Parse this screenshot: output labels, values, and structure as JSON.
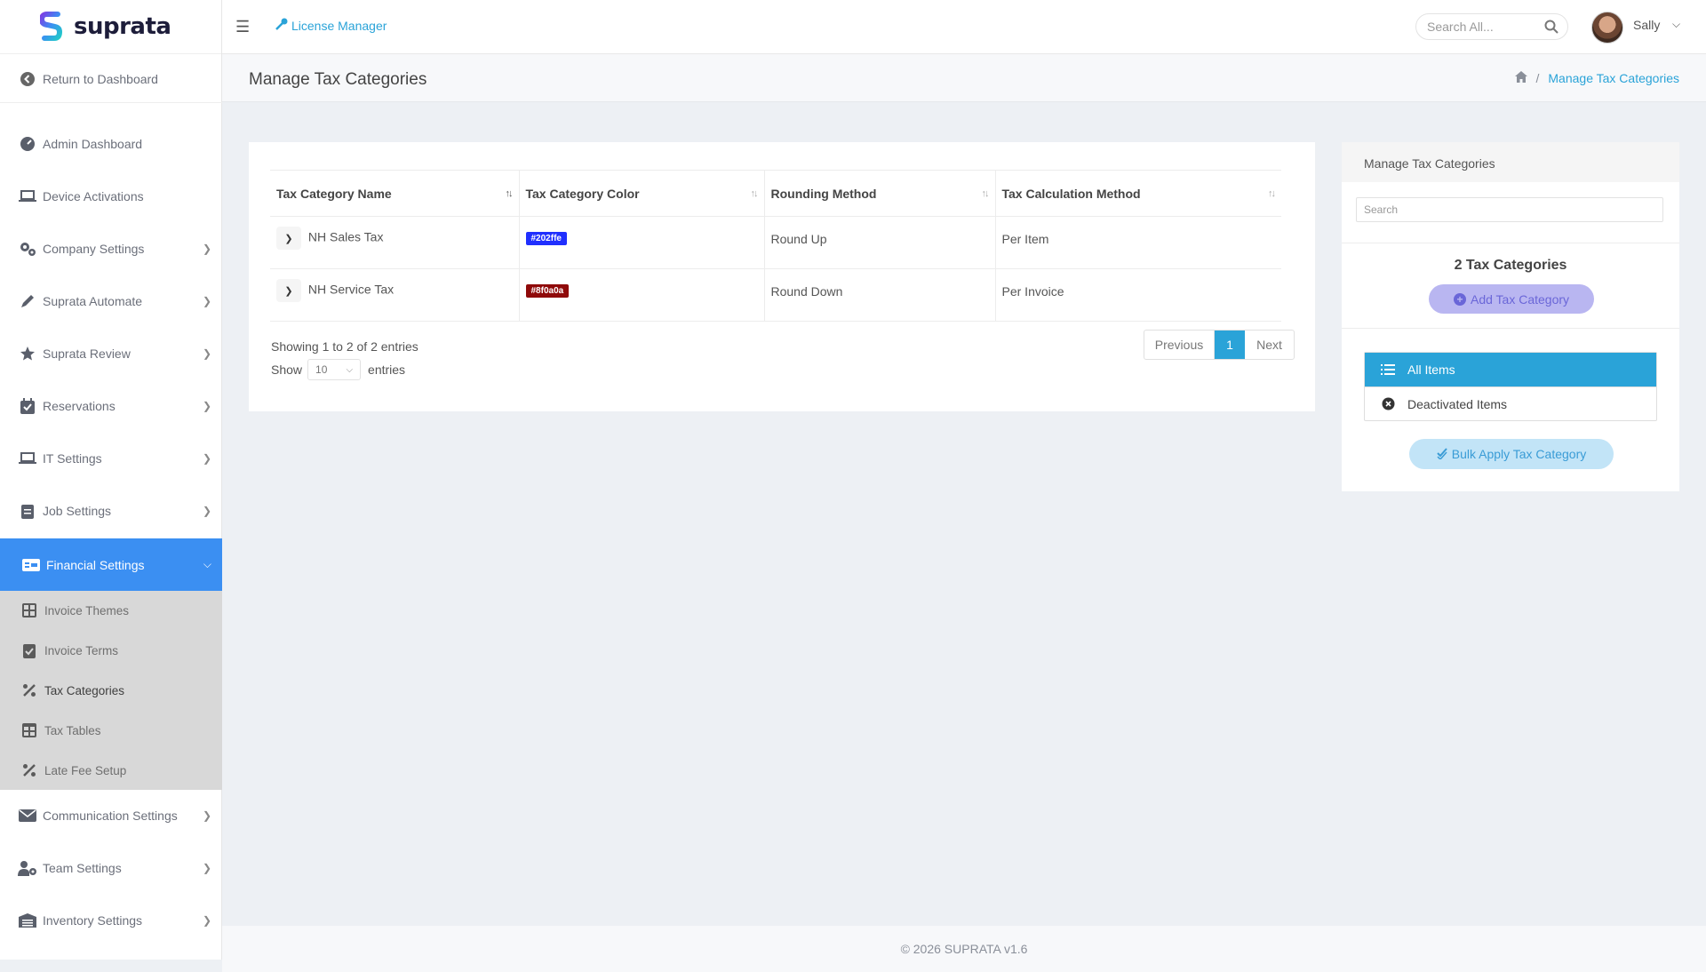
{
  "app": {
    "brand": "suprata",
    "brand_colors": {
      "primary": "#3b8ff2",
      "accent": "#2aa3d8"
    }
  },
  "sidebar": {
    "return_label": "Return to Dashboard",
    "items": [
      {
        "label": "Admin Dashboard",
        "icon": "gauge-icon",
        "has_children": false
      },
      {
        "label": "Device Activations",
        "icon": "laptop-icon",
        "has_children": false
      },
      {
        "label": "Company Settings",
        "icon": "gears-icon",
        "has_children": true
      },
      {
        "label": "Suprata Automate",
        "icon": "pen-icon",
        "has_children": true
      },
      {
        "label": "Suprata Review",
        "icon": "star-icon",
        "has_children": true
      },
      {
        "label": "Reservations",
        "icon": "calendar-check-icon",
        "has_children": true
      },
      {
        "label": "IT Settings",
        "icon": "laptop-icon",
        "has_children": true
      },
      {
        "label": "Job Settings",
        "icon": "clipboard-icon",
        "has_children": true
      },
      {
        "label": "Financial Settings",
        "icon": "money-check-icon",
        "has_children": true,
        "expanded": true
      },
      {
        "label": "Communication Settings",
        "icon": "envelope-icon",
        "has_children": true
      },
      {
        "label": "Team Settings",
        "icon": "user-gear-icon",
        "has_children": true
      },
      {
        "label": "Inventory Settings",
        "icon": "warehouse-icon",
        "has_children": true
      }
    ],
    "submenu": [
      {
        "label": "Invoice Themes",
        "icon": "grid-icon"
      },
      {
        "label": "Invoice Terms",
        "icon": "clipboard-check-icon"
      },
      {
        "label": "Tax Categories",
        "icon": "percent-icon",
        "current": true
      },
      {
        "label": "Tax Tables",
        "icon": "table-icon"
      },
      {
        "label": "Late Fee Setup",
        "icon": "percent-icon"
      }
    ]
  },
  "topbar": {
    "license_label": "License Manager",
    "search_placeholder": "Search All...",
    "user_name": "Sally"
  },
  "page": {
    "title": "Manage Tax Categories",
    "breadcrumb_current": "Manage Tax Categories"
  },
  "table": {
    "columns": [
      "Tax Category Name",
      "Tax Category Color",
      "Rounding Method",
      "Tax Calculation Method"
    ],
    "rows": [
      {
        "name": "NH Sales Tax",
        "color": "#202ffe",
        "rounding": "Round Up",
        "calculation": "Per Item"
      },
      {
        "name": "NH Service Tax",
        "color": "#8f0a0a",
        "rounding": "Round Down",
        "calculation": "Per Invoice"
      }
    ],
    "showing_text": "Showing 1 to 2 of 2 entries",
    "show_label": "Show",
    "page_size": "10",
    "entries_label": "entries",
    "pagination": {
      "previous": "Previous",
      "current": "1",
      "next": "Next"
    }
  },
  "side_panel": {
    "header": "Manage Tax Categories",
    "search_placeholder": "Search",
    "count_text": "2 Tax Categories",
    "add_button": "Add Tax Category",
    "filters": [
      {
        "label": "All Items",
        "icon": "list-icon",
        "active": true
      },
      {
        "label": "Deactivated Items",
        "icon": "circle-x-icon",
        "active": false
      }
    ],
    "bulk_button": "Bulk Apply Tax Category"
  },
  "footer": {
    "text": "© 2026 SUPRATA v1.6"
  }
}
